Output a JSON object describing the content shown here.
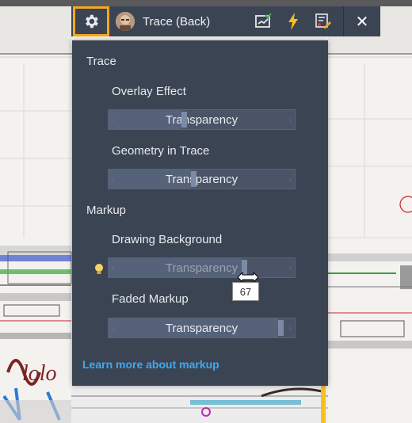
{
  "toolbar": {
    "user_label": "Trace (Back)",
    "icons": [
      "gear-icon",
      "avatar",
      "trace-compare-icon",
      "lightning-icon",
      "markup-edit-icon",
      "close-icon"
    ],
    "close_glyph": "✕",
    "accent_color": "#f5a81e"
  },
  "panel": {
    "section_trace": "Trace",
    "overlay_effect_label": "Overlay Effect",
    "overlay_effect_slider": {
      "label": "Transparency",
      "value_fraction": 0.4
    },
    "geometry_label": "Geometry in Trace",
    "geometry_slider": {
      "label": "Transparency",
      "value_fraction": 0.45
    },
    "section_markup": "Markup",
    "drawing_bg_label": "Drawing Background",
    "drawing_bg_slider": {
      "label": "Transparency",
      "value": 67
    },
    "drawing_bg_tooltip": "67",
    "faded_markup_label": "Faded Markup",
    "faded_markup_slider": {
      "label": "Transparency",
      "value_fraction": 0.93
    },
    "learn_more": "Learn more about markup",
    "link_color": "#3fa9f5"
  }
}
